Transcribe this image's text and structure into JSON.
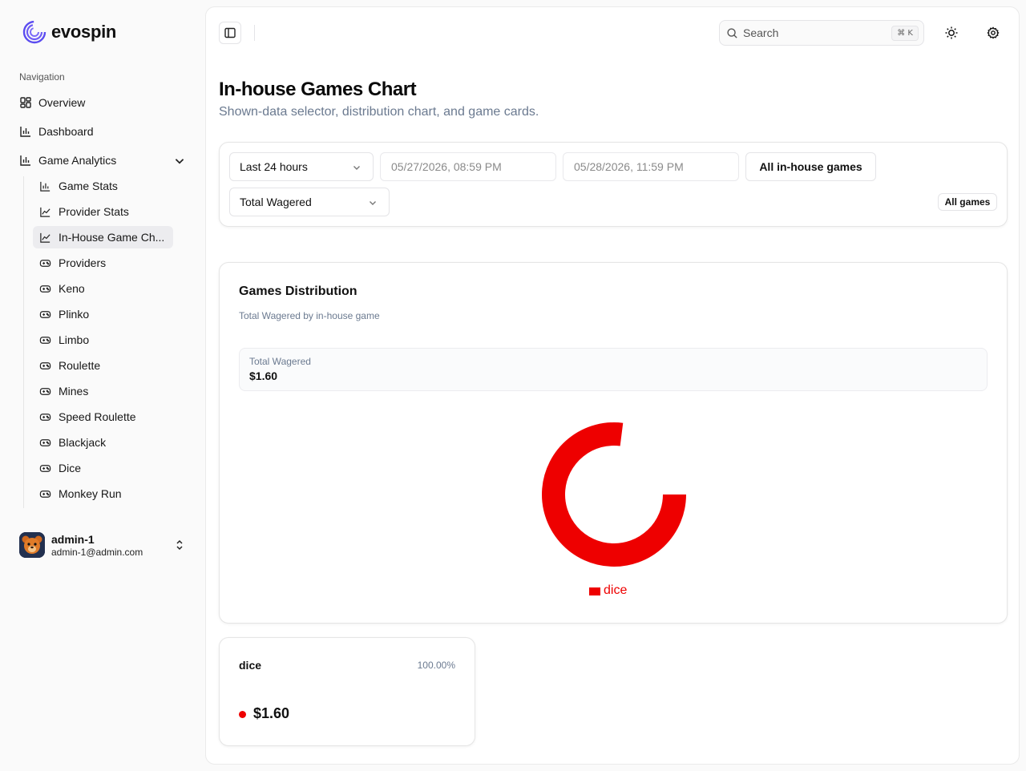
{
  "brand": {
    "name": "evospin"
  },
  "sidebar": {
    "heading": "Navigation",
    "items": [
      {
        "label": "Overview",
        "icon": "grid-icon"
      },
      {
        "label": "Dashboard",
        "icon": "bar-chart-icon"
      },
      {
        "label": "Game Analytics",
        "icon": "bar-chart-icon",
        "expanded": true
      }
    ],
    "sub_items": [
      {
        "label": "Game Stats",
        "icon": "bar-chart-icon"
      },
      {
        "label": "Provider Stats",
        "icon": "line-chart-icon"
      },
      {
        "label": "In-House Game Ch...",
        "icon": "line-chart-icon",
        "active": true
      },
      {
        "label": "Providers",
        "icon": "gamepad-icon"
      },
      {
        "label": "Keno",
        "icon": "gamepad-icon"
      },
      {
        "label": "Plinko",
        "icon": "gamepad-icon"
      },
      {
        "label": "Limbo",
        "icon": "gamepad-icon"
      },
      {
        "label": "Roulette",
        "icon": "gamepad-icon"
      },
      {
        "label": "Mines",
        "icon": "gamepad-icon"
      },
      {
        "label": "Speed Roulette",
        "icon": "gamepad-icon"
      },
      {
        "label": "Blackjack",
        "icon": "gamepad-icon"
      },
      {
        "label": "Dice",
        "icon": "gamepad-icon"
      },
      {
        "label": "Monkey Run",
        "icon": "gamepad-icon"
      }
    ]
  },
  "user": {
    "name": "admin-1",
    "email": "admin-1@admin.com"
  },
  "header": {
    "search_placeholder": "Search",
    "search_shortcut": "⌘ K"
  },
  "page": {
    "title": "In-house Games Chart",
    "subtitle": "Shown-data selector, distribution chart, and game cards."
  },
  "filters": {
    "range": "Last 24 hours",
    "start": "05/27/2026, 08:59 PM",
    "end": "05/28/2026, 11:59 PM",
    "games_button": "All in-house games",
    "metric": "Total Wagered",
    "badge": "All games"
  },
  "distribution": {
    "title": "Games Distribution",
    "description": "Total Wagered by in-house game",
    "total_label": "Total Wagered",
    "total_value": "$1.60"
  },
  "colors": {
    "dice": "#ee0000",
    "accent": "#5b4cf0"
  },
  "chart_data": {
    "type": "pie",
    "variant": "donut",
    "categories": [
      "dice"
    ],
    "values": [
      1.6
    ],
    "legend": [
      "dice"
    ],
    "legend_placement": "bottom"
  },
  "game_cards": [
    {
      "name": "dice",
      "share": "100.00%",
      "value": "$1.60"
    }
  ]
}
